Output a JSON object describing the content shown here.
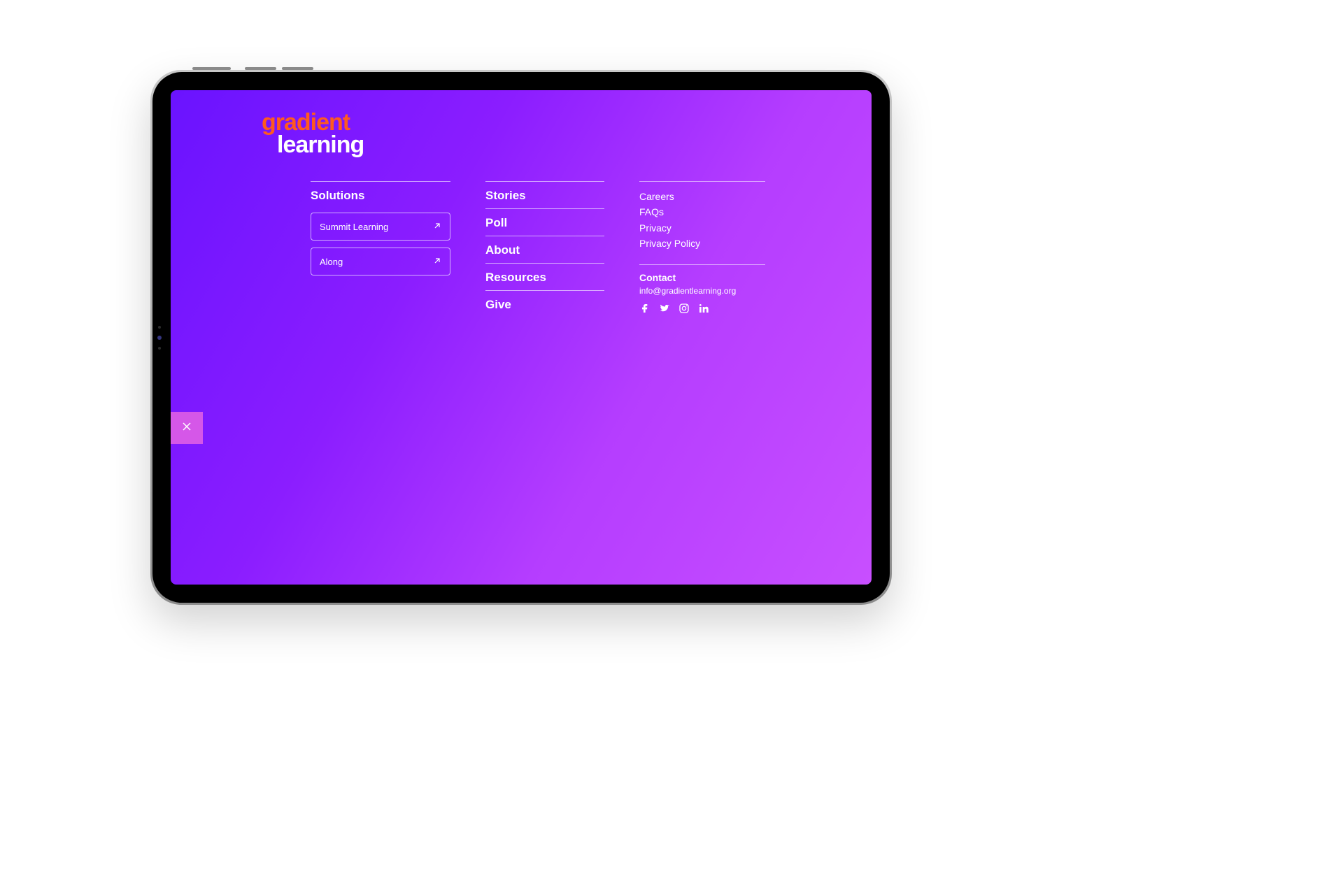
{
  "logo": {
    "line1": "gradient",
    "line2": "learning"
  },
  "columns": {
    "solutions": {
      "heading": "Solutions",
      "buttons": [
        {
          "label": "Summit Learning"
        },
        {
          "label": "Along"
        }
      ]
    },
    "main_nav": {
      "items": [
        "Stories",
        "Poll",
        "About",
        "Resources",
        "Give"
      ]
    },
    "secondary": {
      "links": [
        "Careers",
        "FAQs",
        "Privacy",
        "Privacy Policy"
      ],
      "contact_heading": "Contact",
      "email": "info@gradientlearning.org"
    }
  }
}
